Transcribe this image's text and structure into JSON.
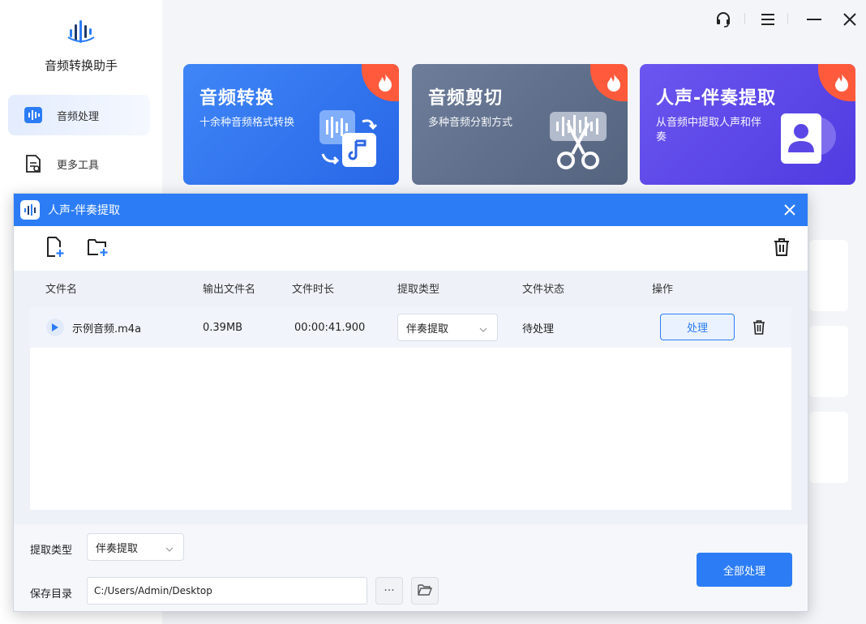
{
  "app": {
    "name": "音频转换助手"
  },
  "sidebar": {
    "items": [
      {
        "label": "音频处理",
        "icon": "audio-wave-icon",
        "active": true
      },
      {
        "label": "更多工具",
        "icon": "document-tools-icon",
        "active": false
      }
    ]
  },
  "window_controls": [
    "headset-icon",
    "menu-icon",
    "minimize-icon",
    "close-icon"
  ],
  "cards": [
    {
      "title": "音频转换",
      "desc": "十余种音频格式转换",
      "icon": "hot-flame-icon"
    },
    {
      "title": "音频剪切",
      "desc": "多种音频分割方式",
      "icon": "hot-flame-icon"
    },
    {
      "title": "人声-伴奏提取",
      "desc": "从音频中提取人声和伴奏",
      "icon": "hot-flame-icon"
    }
  ],
  "dialog": {
    "title": "人声-伴奏提取",
    "toolbar": {
      "add_file": "add-file-icon",
      "add_folder": "add-folder-icon",
      "clear": "trash-icon"
    },
    "columns": [
      "文件名",
      "输出文件名",
      "文件时长",
      "提取类型",
      "文件状态",
      "操作"
    ],
    "rows": [
      {
        "file_name": "示例音频.m4a",
        "output_size": "0.39MB",
        "duration": "00:00:41.900",
        "extract_type": "伴奏提取",
        "status": "待处理",
        "action": "处理"
      }
    ],
    "footer": {
      "type_label": "提取类型",
      "type_value": "伴奏提取",
      "dir_label": "保存目录",
      "dir_value": "C:/Users/Admin/Desktop",
      "more_label": "···",
      "process_all": "全部处理"
    }
  },
  "colors": {
    "primary": "#2c7cf6",
    "hot": "#ff5a3c"
  }
}
